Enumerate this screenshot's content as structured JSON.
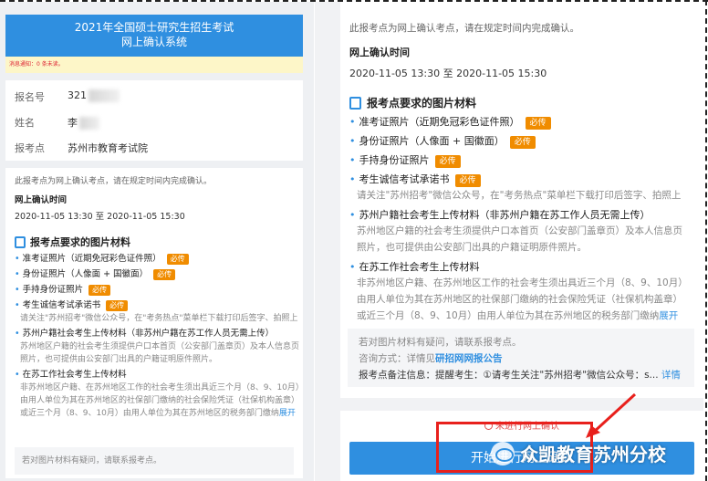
{
  "header": {
    "title_line1": "2021年全国硕士研究生招生考试",
    "title_line2": "网上确认系统",
    "notice": "消息通知：0 条未读。"
  },
  "applicant": {
    "id_label": "报名号",
    "id_value": "321",
    "name_label": "姓名",
    "name_value": "李",
    "site_label": "报考点",
    "site_value": "苏州市教育考试院"
  },
  "confirm": {
    "tip": "此报考点为网上确认考点，请在规定时间内完成确认。",
    "time_label": "网上确认时间",
    "time_value": "2020-11-05 13:30 至 2020-11-05 15:30",
    "section_title": "报考点要求的图片材料",
    "required_badge": "必传",
    "expand_label": "展开",
    "items": [
      {
        "label": "准考证照片（近期免冠彩色证件照）",
        "required": true
      },
      {
        "label": "身份证照片（人像面 + 国徽面）",
        "required": true
      },
      {
        "label": "手持身份证照片",
        "required": true
      },
      {
        "label": "考生诚信考试承诺书",
        "required": true,
        "desc": "请关注\"苏州招考\"微信公众号，在\"考务热点\"菜单栏下载打印后签字、拍照上"
      },
      {
        "label": "苏州户籍社会考生上传材料（非苏州户籍在苏工作人员无需上传）",
        "required": false,
        "desc": "苏州地区户籍的社会考生须提供户口本首页（公安部门盖章页）及本人信息页",
        "desc2": "照片，也可提供由公安部门出具的户籍证明原件照片。"
      },
      {
        "label": "在苏工作社会考生上传材料",
        "required": false,
        "desc": "非苏州地区户籍、在苏州地区工作的社会考生须出具近三个月（8、9、10月）",
        "desc2": "由用人单位为其在苏州地区的社保部门缴纳的社会保险凭证（社保机构盖章）",
        "desc3": "或近三个月（8、9、10月）由用人单位为其在苏州地区的税务部门缴纳"
      }
    ],
    "doubt_tip": "若对图片材料有疑问，请联系报考点。",
    "contact_label": "咨询方式：详情见",
    "contact_link": "研招网网报公告",
    "remark_label": "报考点备注信息：",
    "remark_value": "提醒考生：①请考生关注\"苏州招考\"微信公众号：s...",
    "detail_link": "详情"
  },
  "action": {
    "status": "未进行网上确认",
    "button": "开始进行网上确认"
  },
  "watermark": "众凯教育苏州分校",
  "colors": {
    "primary": "#2f8fe0",
    "badge": "#f08c00",
    "annotation": "#e8201c"
  }
}
